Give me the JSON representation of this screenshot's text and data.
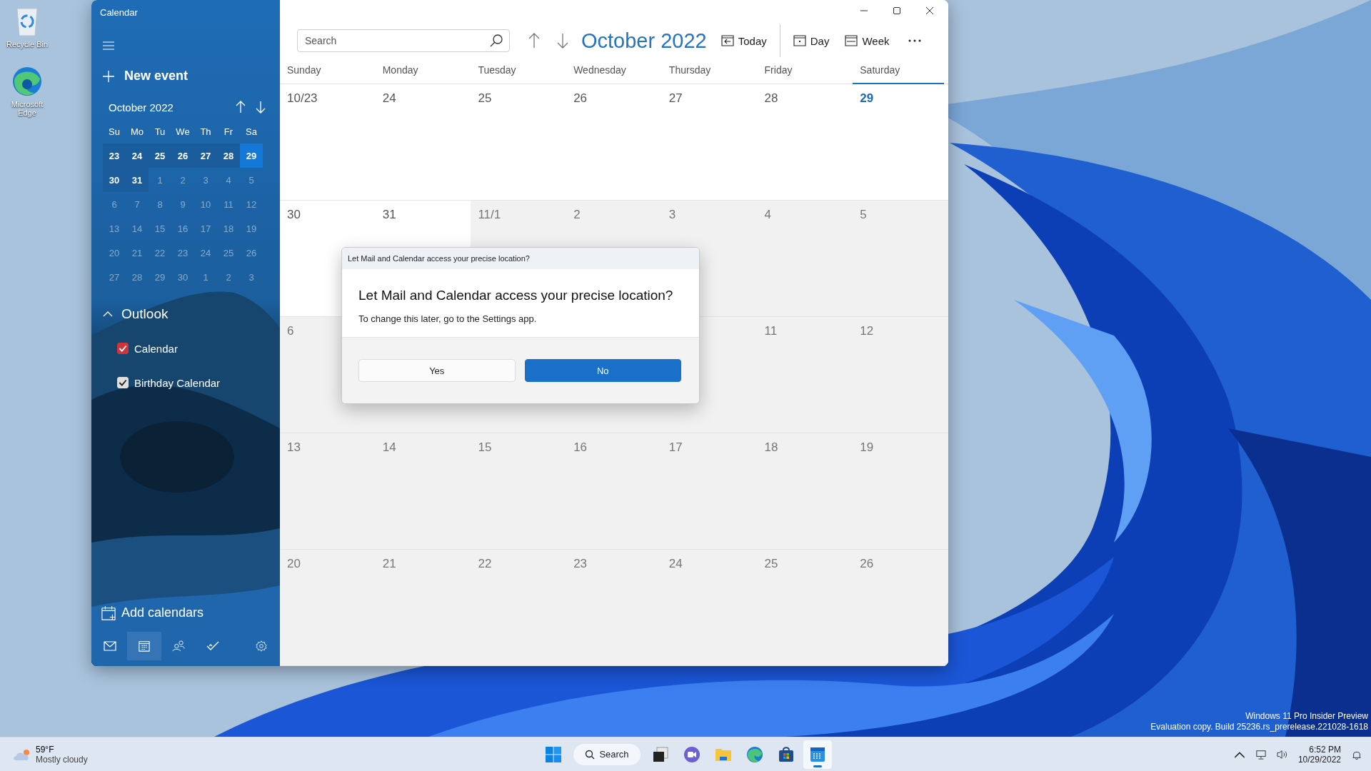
{
  "desktop_icons": [
    {
      "label": "Recycle Bin",
      "kind": "recycle"
    },
    {
      "label": "Microsoft Edge",
      "kind": "edge"
    }
  ],
  "window": {
    "title": "Calendar"
  },
  "sidebar": {
    "new_event": "New event",
    "mini_calendar": {
      "title": "October 2022",
      "weekdays": [
        "Su",
        "Mo",
        "Tu",
        "We",
        "Th",
        "Fr",
        "Sa"
      ],
      "weeks": [
        [
          {
            "label": "23",
            "kind": "range"
          },
          {
            "label": "24",
            "kind": "range"
          },
          {
            "label": "25",
            "kind": "range"
          },
          {
            "label": "26",
            "kind": "range"
          },
          {
            "label": "27",
            "kind": "range"
          },
          {
            "label": "28",
            "kind": "range"
          },
          {
            "label": "29",
            "kind": "today"
          }
        ],
        [
          {
            "label": "30",
            "kind": "range"
          },
          {
            "label": "31",
            "kind": "range"
          },
          {
            "label": "1",
            "kind": "other"
          },
          {
            "label": "2",
            "kind": "other"
          },
          {
            "label": "3",
            "kind": "other"
          },
          {
            "label": "4",
            "kind": "other"
          },
          {
            "label": "5",
            "kind": "other"
          }
        ],
        [
          {
            "label": "6",
            "kind": "other"
          },
          {
            "label": "7",
            "kind": "other"
          },
          {
            "label": "8",
            "kind": "other"
          },
          {
            "label": "9",
            "kind": "other"
          },
          {
            "label": "10",
            "kind": "other"
          },
          {
            "label": "11",
            "kind": "other"
          },
          {
            "label": "12",
            "kind": "other"
          }
        ],
        [
          {
            "label": "13",
            "kind": "other"
          },
          {
            "label": "14",
            "kind": "other"
          },
          {
            "label": "15",
            "kind": "other"
          },
          {
            "label": "16",
            "kind": "other"
          },
          {
            "label": "17",
            "kind": "other"
          },
          {
            "label": "18",
            "kind": "other"
          },
          {
            "label": "19",
            "kind": "other"
          }
        ],
        [
          {
            "label": "20",
            "kind": "other"
          },
          {
            "label": "21",
            "kind": "other"
          },
          {
            "label": "22",
            "kind": "other"
          },
          {
            "label": "23",
            "kind": "other"
          },
          {
            "label": "24",
            "kind": "other"
          },
          {
            "label": "25",
            "kind": "other"
          },
          {
            "label": "26",
            "kind": "other"
          }
        ],
        [
          {
            "label": "27",
            "kind": "other"
          },
          {
            "label": "28",
            "kind": "other"
          },
          {
            "label": "29",
            "kind": "other"
          },
          {
            "label": "30",
            "kind": "other"
          },
          {
            "label": "1",
            "kind": "other"
          },
          {
            "label": "2",
            "kind": "other"
          },
          {
            "label": "3",
            "kind": "other"
          }
        ]
      ]
    },
    "account": {
      "name": "Outlook",
      "expanded": true
    },
    "calendars": [
      {
        "name": "Calendar",
        "checked": true,
        "color": "#d13438"
      },
      {
        "name": "Birthday Calendar",
        "checked": true,
        "color": "#e0e0e0"
      }
    ],
    "add_calendars": "Add calendars",
    "nav": [
      {
        "kind": "mail",
        "selected": false
      },
      {
        "kind": "calendar",
        "selected": true
      },
      {
        "kind": "people",
        "selected": false
      },
      {
        "kind": "todo",
        "selected": false
      },
      {
        "kind": "settings",
        "selected": false
      }
    ]
  },
  "toolbar": {
    "search": {
      "placeholder": "Search"
    },
    "title": "October 2022",
    "buttons": [
      {
        "label": "Today",
        "kind": "today"
      },
      {
        "label": "Day",
        "kind": "day"
      },
      {
        "label": "Week",
        "kind": "week"
      }
    ]
  },
  "month": {
    "weekdays": [
      {
        "label": "Sunday",
        "today": false
      },
      {
        "label": "Monday",
        "today": false
      },
      {
        "label": "Tuesday",
        "today": false
      },
      {
        "label": "Wednesday",
        "today": false
      },
      {
        "label": "Thursday",
        "today": false
      },
      {
        "label": "Friday",
        "today": false
      },
      {
        "label": "Saturday",
        "today": true
      }
    ],
    "weeks": [
      [
        {
          "label": "10/23",
          "in_month": true,
          "today": false
        },
        {
          "label": "24",
          "in_month": true,
          "today": false
        },
        {
          "label": "25",
          "in_month": true,
          "today": false
        },
        {
          "label": "26",
          "in_month": true,
          "today": false
        },
        {
          "label": "27",
          "in_month": true,
          "today": false
        },
        {
          "label": "28",
          "in_month": true,
          "today": false
        },
        {
          "label": "29",
          "in_month": true,
          "today": true
        }
      ],
      [
        {
          "label": "30",
          "in_month": true,
          "today": false
        },
        {
          "label": "31",
          "in_month": true,
          "today": false
        },
        {
          "label": "11/1",
          "in_month": false,
          "today": false
        },
        {
          "label": "2",
          "in_month": false,
          "today": false
        },
        {
          "label": "3",
          "in_month": false,
          "today": false
        },
        {
          "label": "4",
          "in_month": false,
          "today": false
        },
        {
          "label": "5",
          "in_month": false,
          "today": false
        }
      ],
      [
        {
          "label": "6",
          "in_month": false,
          "today": false
        },
        {
          "in_month": false,
          "today": false
        },
        {
          "in_month": false,
          "today": false
        },
        {
          "in_month": false,
          "today": false
        },
        {
          "in_month": false,
          "today": false
        },
        {
          "label": "11",
          "in_month": false,
          "today": false
        },
        {
          "label": "12",
          "in_month": false,
          "today": false
        }
      ],
      [
        {
          "label": "13",
          "in_month": false,
          "today": false
        },
        {
          "label": "14",
          "in_month": false,
          "today": false
        },
        {
          "label": "15",
          "in_month": false,
          "today": false
        },
        {
          "label": "16",
          "in_month": false,
          "today": false
        },
        {
          "label": "17",
          "in_month": false,
          "today": false
        },
        {
          "label": "18",
          "in_month": false,
          "today": false
        },
        {
          "label": "19",
          "in_month": false,
          "today": false
        }
      ],
      [
        {
          "label": "20",
          "in_month": false,
          "today": false
        },
        {
          "label": "21",
          "in_month": false,
          "today": false
        },
        {
          "label": "22",
          "in_month": false,
          "today": false
        },
        {
          "label": "23",
          "in_month": false,
          "today": false
        },
        {
          "label": "24",
          "in_month": false,
          "today": false
        },
        {
          "label": "25",
          "in_month": false,
          "today": false
        },
        {
          "label": "26",
          "in_month": false,
          "today": false
        }
      ]
    ]
  },
  "dialog": {
    "caption": "Let Mail and Calendar access your precise location?",
    "title": "Let Mail and Calendar access your precise location?",
    "message": "To change this later, go to the Settings app.",
    "buttons": [
      {
        "label": "Yes",
        "primary": false
      },
      {
        "label": "No",
        "primary": true
      }
    ]
  },
  "system_notice": [
    "Windows 11 Pro Insider Preview",
    "Evaluation copy. Build 25236.rs_prerelease.221028-1618"
  ],
  "taskbar": {
    "weather": {
      "temperature": "59°F",
      "condition": "Mostly cloudy"
    },
    "apps": [
      {
        "kind": "start",
        "selected": false
      },
      {
        "kind": "search",
        "label": "Search",
        "selected": false
      },
      {
        "kind": "taskview",
        "selected": false
      },
      {
        "kind": "chat",
        "selected": false
      },
      {
        "kind": "explorer",
        "selected": false
      },
      {
        "kind": "edge",
        "selected": false
      },
      {
        "kind": "store",
        "selected": false
      },
      {
        "kind": "calendar",
        "selected": true
      }
    ],
    "tray": {
      "time": "6:52 PM",
      "date": "10/29/2022"
    }
  }
}
